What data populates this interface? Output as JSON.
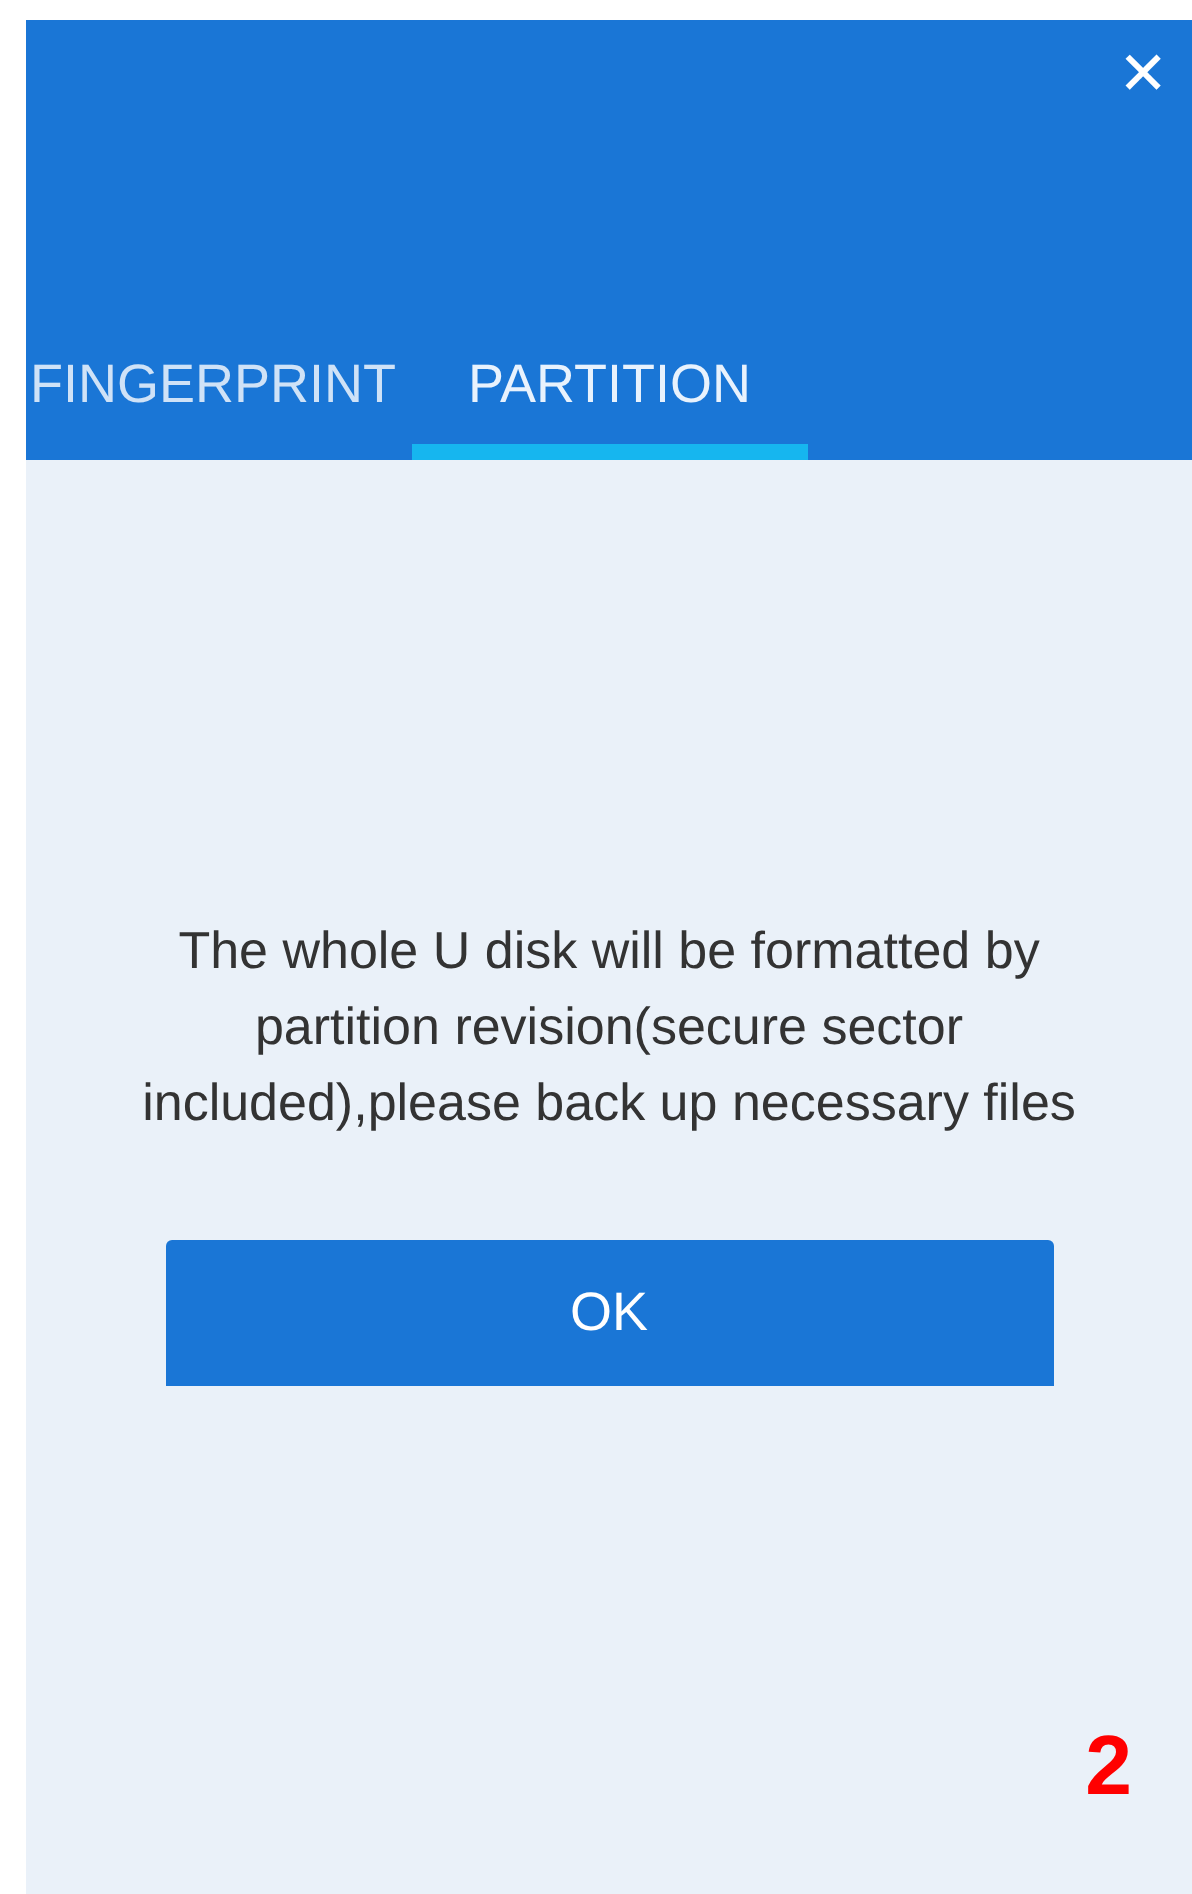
{
  "header": {
    "close_icon": "✕"
  },
  "tabs": [
    {
      "label": "FINGERPRINT",
      "selected": false
    },
    {
      "label": "PARTITION",
      "selected": true
    }
  ],
  "message": "The whole U disk will be formatted by partition revision(secure sector included),please back up necessary files",
  "buttons": [
    {
      "label": "OK"
    }
  ],
  "page_number": "2"
}
